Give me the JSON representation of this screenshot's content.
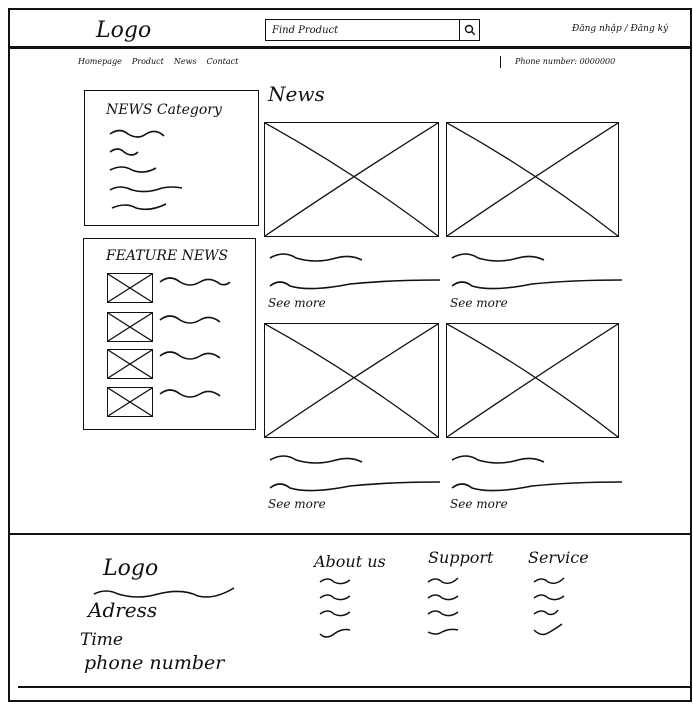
{
  "header": {
    "logo": "Logo",
    "search": {
      "placeholder": "Find Product",
      "icon": "search-icon"
    },
    "auth_link": "Đăng nhập / Đăng ký"
  },
  "nav": {
    "items": [
      "Homepage",
      "Product",
      "News",
      "Contact"
    ],
    "phone": "Phone number: 0000000"
  },
  "sidebar": {
    "category_title": "NEWS Category",
    "featured_title": "FEATURE NEWS"
  },
  "main": {
    "title": "News",
    "cards": [
      {
        "link": "See more"
      },
      {
        "link": "See more"
      },
      {
        "link": "See more"
      },
      {
        "link": "See more"
      }
    ]
  },
  "footer": {
    "logo": "Logo",
    "address": "Adress",
    "time": "Time",
    "phone": "phone number",
    "columns": [
      "About us",
      "Support",
      "Service"
    ]
  }
}
